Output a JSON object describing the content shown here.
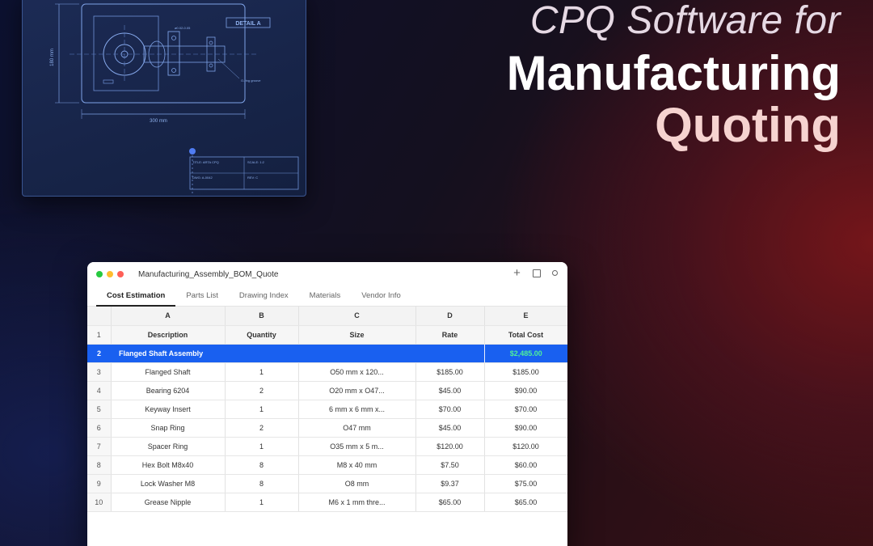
{
  "hero": {
    "line1": "CPQ Software for",
    "line2": "Manufacturing",
    "line3": "Quoting"
  },
  "blueprint": {
    "detail_label": "DETAIL A",
    "dim_height": "180 mm",
    "dim_width": "300 mm",
    "tolerance": "⌀0.02-0.05",
    "note": "O-ring groove",
    "title_block": {
      "title": "TITLE: ARTA CPQ",
      "scale": "SCALE: 1:2",
      "dwg": "DWG: A-0042",
      "rev": "REV: C"
    }
  },
  "window": {
    "title": "Manufacturing_Assembly_BOM_Quote",
    "controls": [
      "plus-icon",
      "square-icon",
      "circle-icon"
    ],
    "traffic_lights": {
      "green": "#27c93f",
      "yellow": "#ffbd2e",
      "red": "#ff5f57"
    }
  },
  "tabs": [
    {
      "label": "Cost Estimation",
      "active": true
    },
    {
      "label": "Parts List",
      "active": false
    },
    {
      "label": "Drawing Index",
      "active": false
    },
    {
      "label": "Materials",
      "active": false
    },
    {
      "label": "Vendor Info",
      "active": false
    }
  ],
  "sheet": {
    "column_letters": [
      "A",
      "B",
      "C",
      "D",
      "E"
    ],
    "headers": {
      "row": "1",
      "description": "Description",
      "quantity": "Quantity",
      "size": "Size",
      "rate": "Rate",
      "total": "Total Cost"
    },
    "assembly": {
      "row": "2",
      "description": "Flanged Shaft Assembly",
      "total": "$2,485.00",
      "highlight_color": "#1960f0",
      "total_color": "#4ef09a"
    },
    "rows": [
      {
        "row": "3",
        "description": "Flanged Shaft",
        "quantity": "1",
        "size": "O50 mm x 120...",
        "rate": "$185.00",
        "total": "$185.00"
      },
      {
        "row": "4",
        "description": "Bearing 6204",
        "quantity": "2",
        "size": "O20 mm x O47...",
        "rate": "$45.00",
        "total": "$90.00"
      },
      {
        "row": "5",
        "description": "Keyway Insert",
        "quantity": "1",
        "size": "6 mm x 6 mm x...",
        "rate": "$70.00",
        "total": "$70.00"
      },
      {
        "row": "6",
        "description": "Snap Ring",
        "quantity": "2",
        "size": "O47 mm",
        "rate": "$45.00",
        "total": "$90.00"
      },
      {
        "row": "7",
        "description": "Spacer Ring",
        "quantity": "1",
        "size": "O35 mm x 5 m...",
        "rate": "$120.00",
        "total": "$120.00"
      },
      {
        "row": "8",
        "description": "Hex Bolt M8x40",
        "quantity": "8",
        "size": "M8 x 40 mm",
        "rate": "$7.50",
        "total": "$60.00"
      },
      {
        "row": "9",
        "description": "Lock Washer M8",
        "quantity": "8",
        "size": "O8 mm",
        "rate": "$9.37",
        "total": "$75.00"
      },
      {
        "row": "10",
        "description": "Grease Nipple",
        "quantity": "1",
        "size": "M6 x 1 mm thre...",
        "rate": "$65.00",
        "total": "$65.00"
      }
    ]
  }
}
